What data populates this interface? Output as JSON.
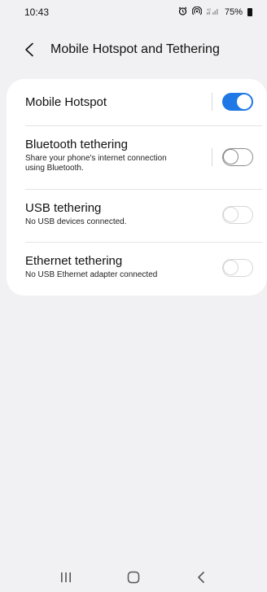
{
  "status_bar": {
    "time": "10:43",
    "battery": "75%"
  },
  "header": {
    "title": "Mobile Hotspot and Tethering"
  },
  "settings": [
    {
      "title": "Mobile Hotspot",
      "subtitle": "",
      "state": "on"
    },
    {
      "title": "Bluetooth tethering",
      "subtitle_line1": "Share your phone's internet connection",
      "subtitle_line2": "using Bluetooth.",
      "state": "off"
    },
    {
      "title": "USB tethering",
      "subtitle": "No USB devices connected.",
      "state": "disabled"
    },
    {
      "title": "Ethernet tethering",
      "subtitle": "No USB Ethernet adapter connected",
      "state": "disabled"
    }
  ],
  "colors": {
    "accent": "#1f78e6",
    "background": "#f1f1f3",
    "card": "#ffffff"
  },
  "icons": {
    "back": "chevron-left-icon",
    "alarm": "alarm-icon",
    "hotspot": "hotspot-icon",
    "signal": "signal-icon",
    "battery": "battery-icon",
    "recents": "recents-icon",
    "home": "home-icon",
    "nav_back": "nav-back-icon"
  }
}
